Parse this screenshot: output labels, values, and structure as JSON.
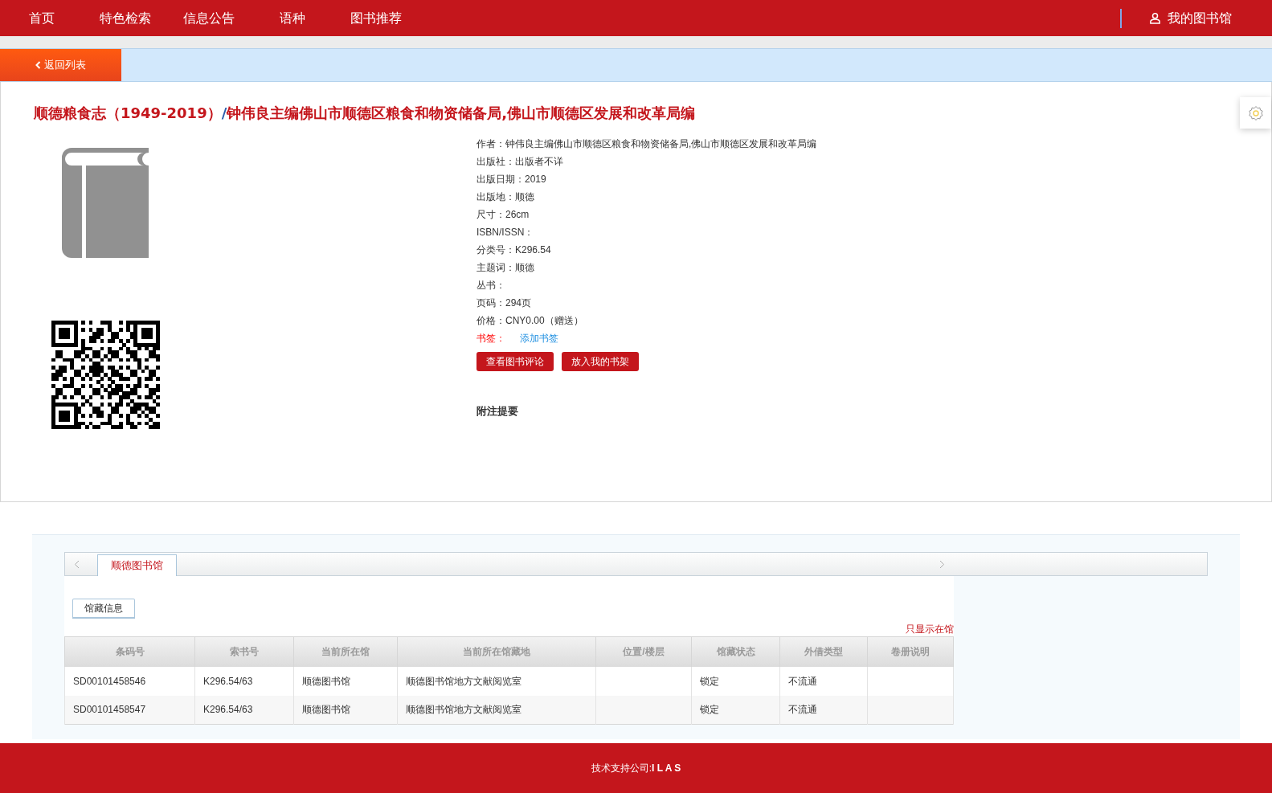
{
  "nav": {
    "items": [
      {
        "label": "首页"
      },
      {
        "label": "特色检索"
      },
      {
        "label": "信息公告"
      },
      {
        "label": "语种"
      },
      {
        "label": "图书推荐"
      }
    ],
    "account": "我的图书馆"
  },
  "back_button": "返回列表",
  "title": {
    "main": "顺德粮食志（1949-2019）",
    "separator": "/",
    "responsibility": "钟伟良主编佛山市顺德区粮食和物资储备局,佛山市顺德区发展和改革局编"
  },
  "fields": [
    {
      "kind": "text",
      "label": "作者：",
      "value": "钟伟良主编佛山市顺德区粮食和物资储备局,佛山市顺德区发展和改革局编"
    },
    {
      "kind": "text",
      "label": "出版社：",
      "value": "出版者不详"
    },
    {
      "kind": "text",
      "label": "出版日期：",
      "value": "2019"
    },
    {
      "kind": "text",
      "label": "出版地：",
      "value": "顺德"
    },
    {
      "kind": "text",
      "label": "尺寸：",
      "value": "26cm"
    },
    {
      "kind": "text",
      "label": "ISBN/ISSN："
    },
    {
      "kind": "text",
      "label": "分类号：",
      "value": "K296.54"
    },
    {
      "kind": "text",
      "label": "主题词：",
      "value": "顺德"
    },
    {
      "kind": "text",
      "label": "丛书："
    },
    {
      "kind": "text",
      "label": "页码：",
      "value": "294页"
    },
    {
      "kind": "text",
      "label": "价格：",
      "value": "CNY0.00（赠送）"
    },
    {
      "kind": "link",
      "label": "书签：",
      "value": "添加书签"
    }
  ],
  "actions": [
    "查看图书评论",
    "放入我的书架"
  ],
  "notes_heading": "附注提要",
  "library_tabs": [
    {
      "label": "顺德图书馆",
      "selected": true
    }
  ],
  "sub_tabs": [
    {
      "label": "馆藏信息",
      "selected": true
    }
  ],
  "filter_link": "只显示在馆",
  "table": {
    "columns": [
      "条码号",
      "索书号",
      "当前所在馆",
      "当前所在馆藏地",
      "位置/楼层",
      "馆藏状态",
      "外借类型",
      "卷册说明"
    ],
    "rows": [
      [
        "SD00101458546",
        "K296.54/63",
        "顺德图书馆",
        "顺德图书馆地方文献阅览室",
        "",
        "锁定",
        "不流通",
        ""
      ],
      [
        "SD00101458547",
        "K296.54/63",
        "顺德图书馆",
        "顺德图书馆地方文献阅览室",
        "",
        "锁定",
        "不流通",
        ""
      ]
    ]
  },
  "footer": {
    "label": "技术支持公司:",
    "company": "I L A S"
  }
}
